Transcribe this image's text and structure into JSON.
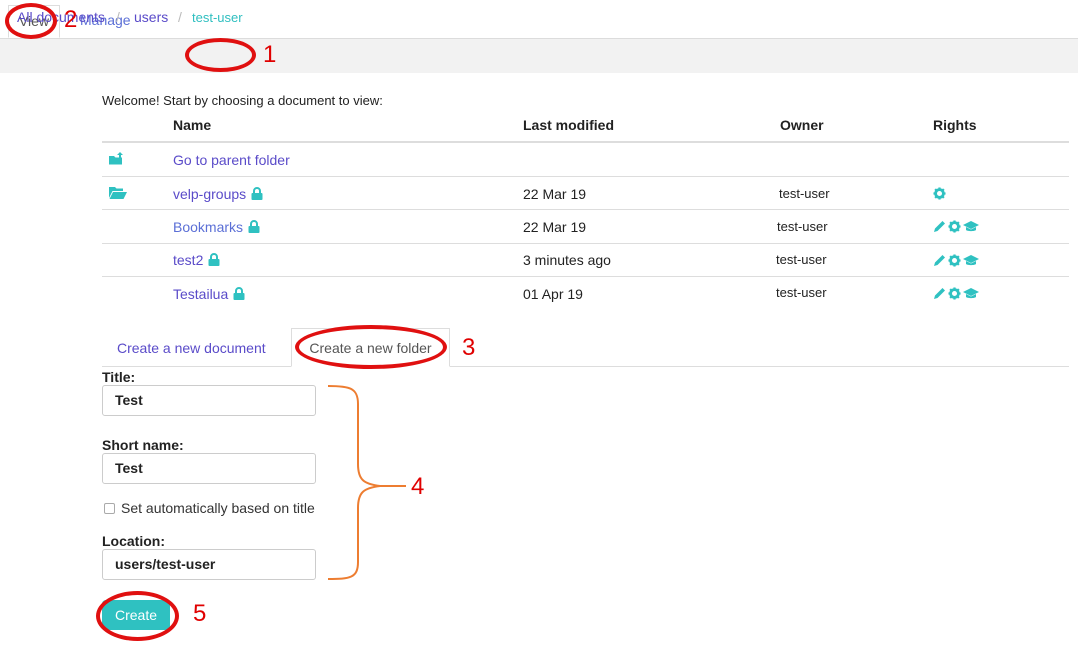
{
  "top_tabs": {
    "view": "View",
    "manage": "Manage"
  },
  "breadcrumb": {
    "items": [
      "All documents",
      "users",
      "test-user"
    ],
    "separator": "/"
  },
  "welcome": "Welcome! Start by choosing a document to view:",
  "table": {
    "headers": {
      "name": "Name",
      "last_modified": "Last modified",
      "owner": "Owner",
      "rights": "Rights"
    },
    "parent": "Go to parent folder",
    "rows": [
      {
        "name": "velp-groups",
        "modified": "22 Mar 19",
        "owner": "test-user",
        "rights": [
          "gear-icon"
        ]
      },
      {
        "name": "Bookmarks",
        "modified": "22 Mar 19",
        "owner": "test-user",
        "rights": [
          "pencil-icon",
          "gear-icon",
          "graduation-cap-icon"
        ]
      },
      {
        "name": "test2",
        "modified": "3 minutes ago",
        "owner": "test-user",
        "rights": [
          "pencil-icon",
          "gear-icon",
          "graduation-cap-icon"
        ]
      },
      {
        "name": "Testailua",
        "modified": "01 Apr 19",
        "owner": "test-user",
        "rights": [
          "pencil-icon",
          "gear-icon",
          "graduation-cap-icon"
        ]
      }
    ]
  },
  "tabs": {
    "new_document": "Create a new document",
    "new_folder": "Create a new folder"
  },
  "form": {
    "title_label": "Title:",
    "title_value": "Test",
    "short_name_label": "Short name:",
    "short_name_value": "Test",
    "auto_label": "Set automatically based on title",
    "location_label": "Location:",
    "location_value": "users/test-user",
    "create_label": "Create"
  },
  "annotations": [
    "1",
    "2",
    "3",
    "4",
    "5"
  ],
  "colors": {
    "accent": "#2fc1c1",
    "link": "#5a4bc9",
    "annotation_red": "#e00000",
    "brace_orange": "#ed7d31"
  }
}
